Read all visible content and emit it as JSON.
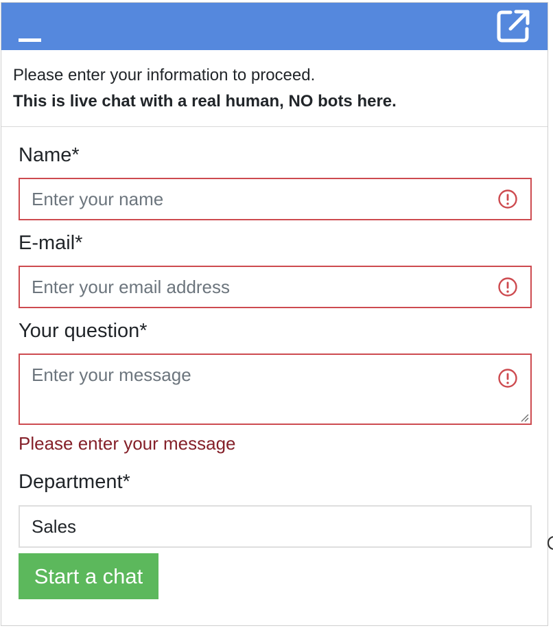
{
  "header": {
    "minimize_icon": "minimize-icon",
    "popout_icon": "external-link-icon",
    "background_color": "#5588dd"
  },
  "intro": {
    "line1": "Please enter your information to proceed.",
    "line2": "This is live chat with a real human, NO bots here."
  },
  "form": {
    "name": {
      "label": "Name*",
      "placeholder": "Enter your name",
      "value": ""
    },
    "email": {
      "label": "E-mail*",
      "placeholder": "Enter your email address",
      "value": ""
    },
    "question": {
      "label": "Your question*",
      "placeholder": "Enter your message",
      "value": "",
      "error": "Please enter your message"
    },
    "department": {
      "label": "Department*",
      "selected": "Sales"
    },
    "submit_label": "Start a chat"
  },
  "colors": {
    "error": "#cd4a4f",
    "error_text": "#842029",
    "submit": "#5cb85c"
  }
}
